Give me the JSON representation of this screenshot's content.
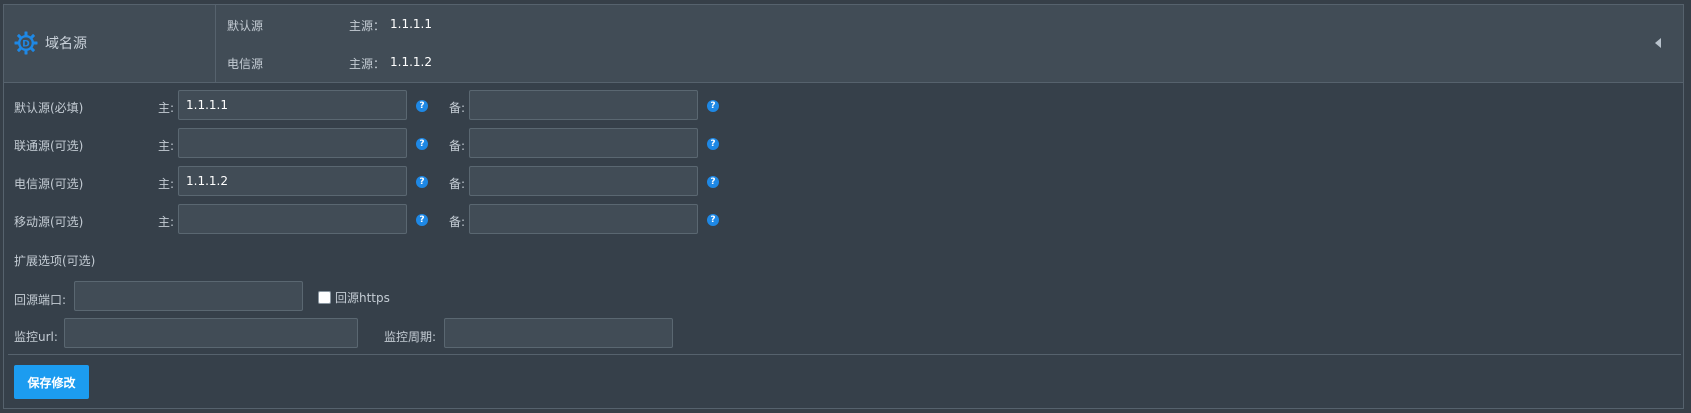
{
  "header": {
    "title": "域名源",
    "icon": "gear-d-icon",
    "summary": [
      {
        "name": "默认源",
        "key": "主源：",
        "value": "1.1.1.1"
      },
      {
        "name": "电信源",
        "key": "主源：",
        "value": "1.1.1.2"
      }
    ]
  },
  "sources": [
    {
      "label": "默认源(必填)",
      "main_label": "主:",
      "main_value": "1.1.1.1",
      "backup_label": "备:",
      "backup_value": ""
    },
    {
      "label": "联通源(可选)",
      "main_label": "主:",
      "main_value": "",
      "backup_label": "备:",
      "backup_value": ""
    },
    {
      "label": "电信源(可选)",
      "main_label": "主:",
      "main_value": "1.1.1.2",
      "backup_label": "备:",
      "backup_value": ""
    },
    {
      "label": "移动源(可选)",
      "main_label": "主:",
      "main_value": "",
      "backup_label": "备:",
      "backup_value": ""
    }
  ],
  "extended": {
    "title": "扩展选项(可选)",
    "port_label": "回源端口:",
    "port_value": "",
    "https_label": "回源https",
    "https_checked": false,
    "url_label": "监控url:",
    "url_value": "",
    "cycle_label": "监控周期:",
    "cycle_value": ""
  },
  "save_label": "保存修改",
  "colors": {
    "accent": "#1c9cf0",
    "help_icon": "#1e88e5",
    "background": "#363f48",
    "header_bg": "#414c56"
  }
}
